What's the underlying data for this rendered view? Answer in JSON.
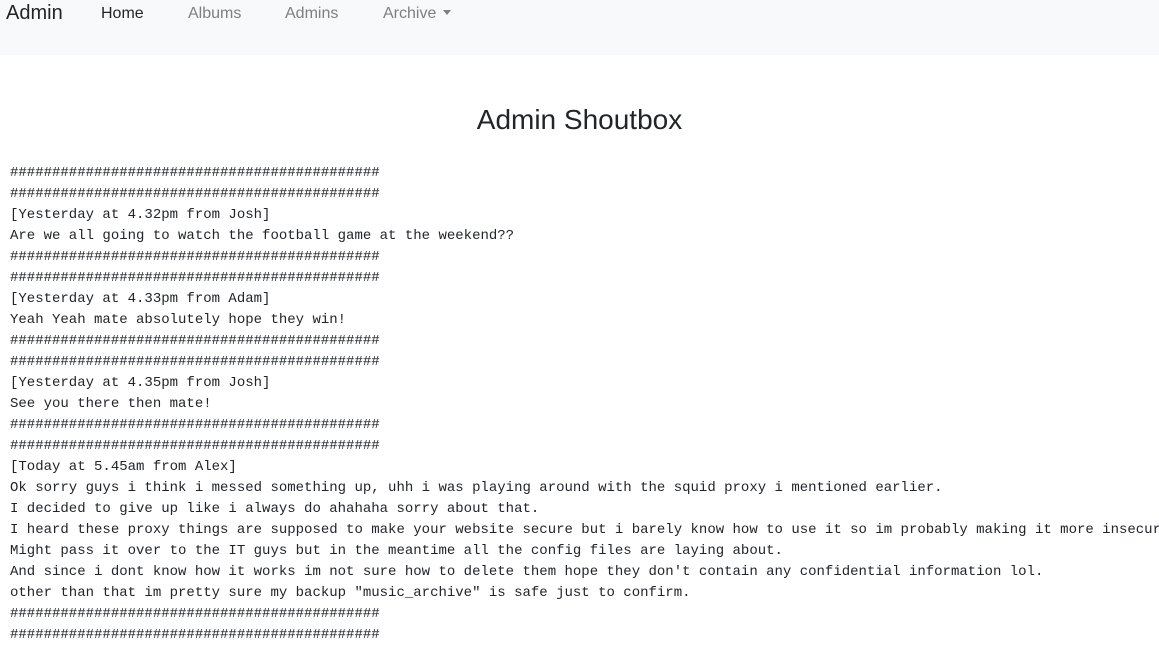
{
  "navbar": {
    "brand": "Admin",
    "links": [
      {
        "label": "Home",
        "active": true
      },
      {
        "label": "Albums",
        "active": false
      },
      {
        "label": "Admins",
        "active": false
      },
      {
        "label": "Archive",
        "active": false,
        "dropdown": true
      }
    ]
  },
  "page": {
    "title": "Admin Shoutbox"
  },
  "shoutbox": {
    "lines": [
      "############################################",
      "############################################",
      "[Yesterday at 4.32pm from Josh]",
      "Are we all going to watch the football game at the weekend??",
      "############################################",
      "############################################",
      "[Yesterday at 4.33pm from Adam]",
      "Yeah Yeah mate absolutely hope they win!",
      "############################################",
      "############################################",
      "[Yesterday at 4.35pm from Josh]",
      "See you there then mate!",
      "############################################",
      "############################################",
      "[Today at 5.45am from Alex]",
      "Ok sorry guys i think i messed something up, uhh i was playing around with the squid proxy i mentioned earlier.",
      "I decided to give up like i always do ahahaha sorry about that.",
      "I heard these proxy things are supposed to make your website secure but i barely know how to use it so im probably making it more insecur",
      "Might pass it over to the IT guys but in the meantime all the config files are laying about.",
      "And since i dont know how it works im not sure how to delete them hope they don't contain any confidential information lol.",
      "other than that im pretty sure my backup \"music_archive\" is safe just to confirm.",
      "############################################",
      "############################################"
    ]
  },
  "colors": {
    "navbar_bg": "#f8f9fa",
    "text": "#212529",
    "nav_inactive": "#7f7f7f"
  }
}
